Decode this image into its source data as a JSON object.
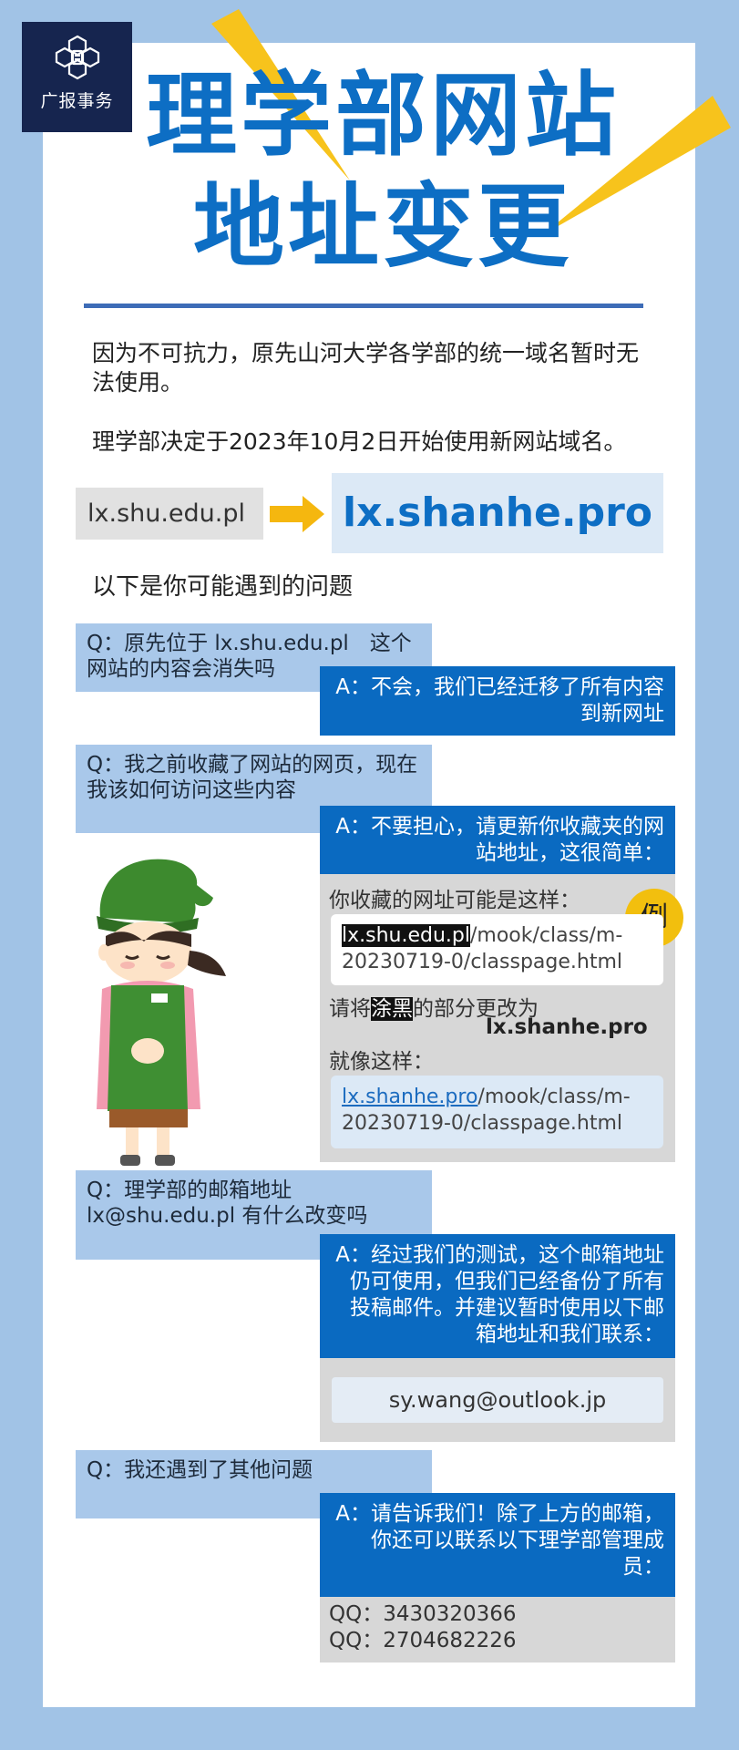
{
  "logo": {
    "text": "广报事务"
  },
  "title": {
    "line1": "理学部网站",
    "line2": "地址变更"
  },
  "intro": {
    "p1": "因为不可抗力，原先山河大学各学部的统一域名暂时无法使用。",
    "p2": "理学部决定于2023年10月2日开始使用新网站域名。"
  },
  "domains": {
    "old": "lx.shu.edu.pl",
    "new": "lx.shanhe.pro"
  },
  "faq_heading": "以下是你可能遇到的问题",
  "faq": [
    {
      "q": "Q：原先位于 lx.shu.edu.pl　这个网站的内容会消失吗",
      "a": "A：不会，我们已经迁移了所有内容到新网址"
    },
    {
      "q": "Q：我之前收藏了网站的网页，现在我该如何访问这些内容",
      "a": "A：不要担心，请更新你收藏夹的网站地址，这很简单："
    },
    {
      "q": "Q：理学部的邮箱地址 lx@shu.edu.pl 有什么改变吗",
      "a": "A：经过我们的测试，这个邮箱地址仍可使用，但我们已经备份了所有投稿邮件。并建议暂时使用以下邮箱地址和我们联系："
    },
    {
      "q": "Q：我还遇到了其他问题",
      "a": "A：请告诉我们！除了上方的邮箱，你还可以联系以下理学部管理成员："
    }
  ],
  "example": {
    "badge": "例",
    "intro": "你收藏的网址可能是这样：",
    "old_hl": "lx.shu.edu.pl",
    "old_rest": "/mook/class/m-20230719-0/classpage.html",
    "instr_a": "请将",
    "instr_b": "涂黑",
    "instr_c": "的部分更改为",
    "instr_new": "lx.shanhe.pro",
    "like": "就像这样：",
    "new_hl": "lx.shanhe.pro",
    "new_rest": "/mook/class/m-20230719-0/classpage.html"
  },
  "contact_email": "sy.wang@outlook.jp",
  "qq": [
    "QQ：3430320366",
    "QQ：2704682226"
  ],
  "colors": {
    "accent": "#0d6ec4",
    "answer_bg": "#0a6ac1",
    "question_bg": "#a9c8ea",
    "frame": "#a1c3e6",
    "badge": "#f2bf0e",
    "logo_bg": "#16254f"
  }
}
